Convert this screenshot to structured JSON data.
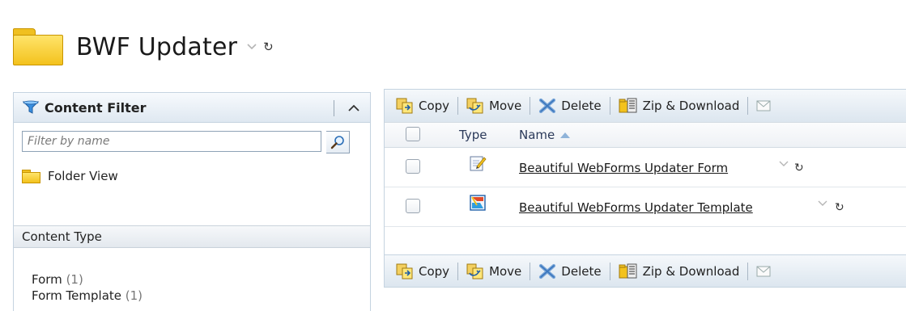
{
  "header": {
    "title": "BWF Updater",
    "folder_icon": "folder-icon",
    "dropdown_icon": "chevron-down-icon",
    "refresh_glyph": "↻"
  },
  "sidebar": {
    "title": "Content Filter",
    "filter_placeholder": "Filter by name",
    "folder_view_label": "Folder View",
    "content_type_header": "Content Type",
    "content_types": [
      {
        "label": "Form",
        "count": "(1)"
      },
      {
        "label": "Form Template",
        "count": "(1)"
      }
    ]
  },
  "toolbar": {
    "copy": "Copy",
    "move": "Move",
    "delete": "Delete",
    "zip": "Zip & Download"
  },
  "grid": {
    "col_type": "Type",
    "col_name": "Name",
    "rows": [
      {
        "name": "Beautiful WebForms Updater Form",
        "type_icon": "form-edit-icon"
      },
      {
        "name": "Beautiful WebForms Updater Template",
        "type_icon": "form-template-icon"
      }
    ]
  },
  "colors": {
    "accent": "#1f5fa8",
    "panel_border": "#c5d3e0",
    "toolbar_bg": "#dce6ef",
    "folder_yellow": "#f3c21d"
  }
}
